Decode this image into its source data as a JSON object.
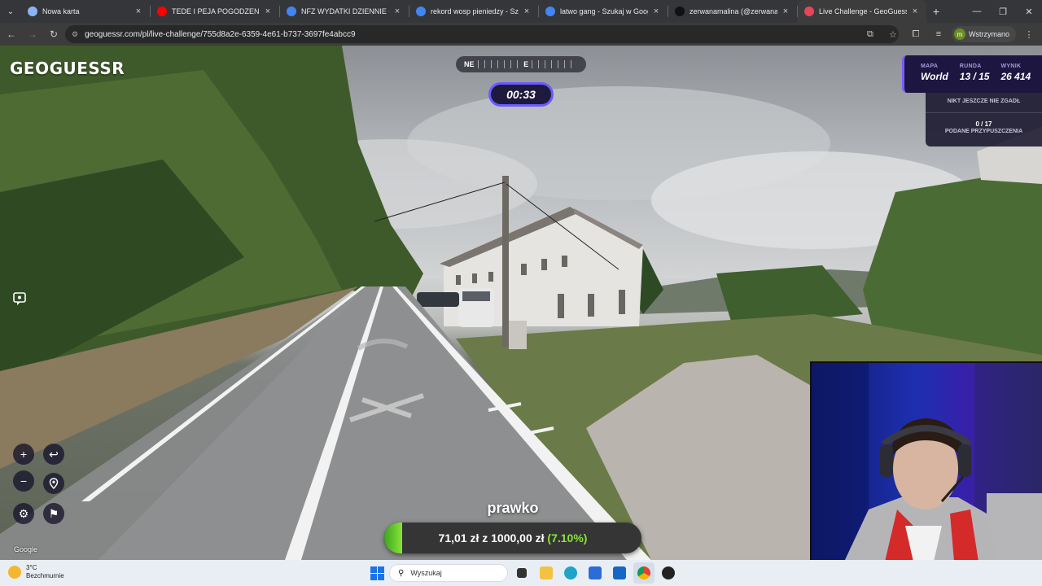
{
  "browser": {
    "tabs": [
      {
        "title": "Nowa karta",
        "icon": "globe-icon",
        "color": "#8ab4f8"
      },
      {
        "title": "TEDE I PEJA POGODZENI? ŁATW",
        "icon": "youtube-icon",
        "color": "#ff0000"
      },
      {
        "title": "NFZ WYDATKI DZIENNIE - Szuk",
        "icon": "google-icon",
        "color": "#4285f4"
      },
      {
        "title": "rekord wosp pieniedzy - Szukaj",
        "icon": "google-icon",
        "color": "#4285f4"
      },
      {
        "title": "latwo gang - Szukaj w Google",
        "icon": "google-icon",
        "color": "#4285f4"
      },
      {
        "title": "zerwanamalina (@zerwanamali",
        "icon": "tiktok-icon",
        "color": "#111111"
      },
      {
        "title": "Live Challenge - GeoGuessr",
        "icon": "geoguessr-icon",
        "color": "#e8455a",
        "active": true
      }
    ],
    "url": "geoguessr.com/pl/live-challenge/755d8a2e-6359-4e61-b737-3697fe4abcc9",
    "profile_initial": "m",
    "profile_label": "Wstrzymano"
  },
  "game": {
    "logo": "GEOGUESSR",
    "compass_left": "NE",
    "compass_right": "E",
    "timer": "00:33",
    "map_label": "MAPA",
    "map_value": "World",
    "round_label": "RUNDA",
    "round_value": "13 / 15",
    "score_label": "WYNIK",
    "score_value": "26 414",
    "nobody_guessed": "NIKT JESZCZE NIE ZGADŁ",
    "guesses_count": "0 / 17",
    "guesses_label": "PODANE PRZYPUSZCZENIA",
    "google_watermark": "Google"
  },
  "donation": {
    "name": "prawko",
    "raised": "71,01 zł",
    "connector": "z",
    "goal": "1000,00 zł",
    "percent_text": "(7.10%)",
    "progress": 0.071
  },
  "taskbar": {
    "temperature": "3°C",
    "weather_desc": "Bezchmurnie",
    "search_placeholder": "Wyszukaj"
  }
}
